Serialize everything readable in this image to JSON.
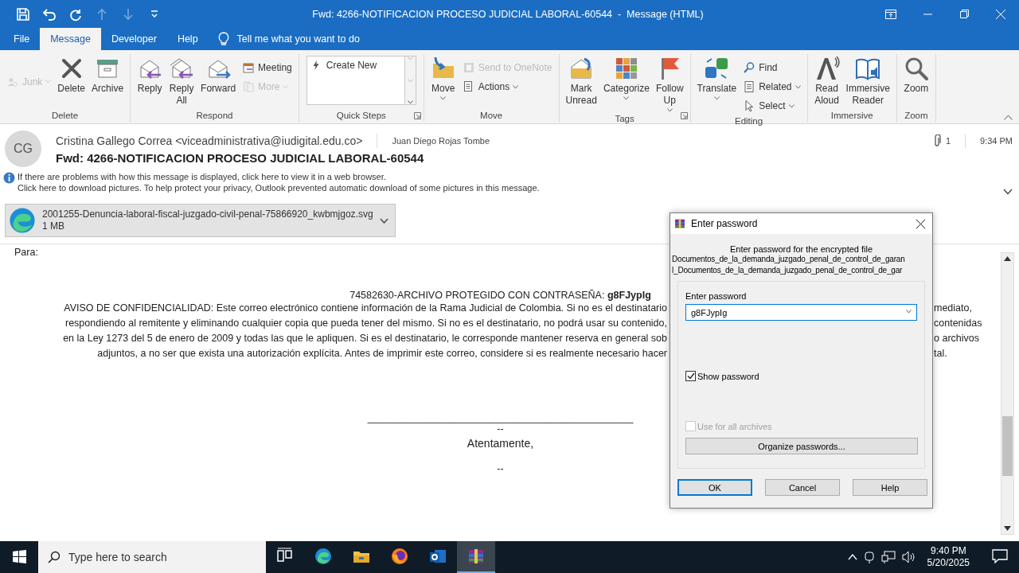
{
  "window": {
    "title": "Fwd: 4266-NOTIFICACION PROCESO JUDICIAL LABORAL-60544  -  Message (HTML)"
  },
  "quick_access": [
    {
      "disabled": false
    },
    {
      "disabled": false
    },
    {
      "disabled": false
    },
    {
      "disabled": true
    },
    {
      "disabled": true
    },
    {
      "disabled": false
    }
  ],
  "tabs": [
    {
      "label": "File",
      "selected": false
    },
    {
      "label": "Message",
      "selected": true
    },
    {
      "label": "Developer",
      "selected": false
    },
    {
      "label": "Help",
      "selected": false
    }
  ],
  "tell_me": {
    "placeholder": "Tell me what you want to do"
  },
  "ribbon": {
    "groups": [
      {
        "label": "Delete",
        "launcher": false,
        "items": [
          {
            "kind": "small",
            "label": "Junk",
            "disabled": true,
            "dropdown": true
          },
          {
            "kind": "large",
            "label": "Delete",
            "disabled": false,
            "dropdown": false
          },
          {
            "kind": "large",
            "label": "Archive",
            "disabled": false,
            "dropdown": false
          }
        ]
      },
      {
        "label": "Respond",
        "launcher": false,
        "items": [
          {
            "kind": "large",
            "label": "Reply",
            "disabled": false,
            "dropdown": false
          },
          {
            "kind": "large",
            "label": "Reply All",
            "disabled": false,
            "dropdown": false
          },
          {
            "kind": "large",
            "label": "Forward",
            "disabled": false,
            "dropdown": false
          },
          {
            "kind": "small",
            "label": "Meeting",
            "disabled": false,
            "dropdown": false
          },
          {
            "kind": "small",
            "label": "More",
            "disabled": true,
            "dropdown": true
          }
        ]
      },
      {
        "label": "Quick Steps",
        "launcher": true,
        "items": [
          {
            "kind": "gallery",
            "label": "Create New",
            "disabled": false,
            "dropdown": false
          }
        ]
      },
      {
        "label": "Move",
        "launcher": false,
        "items": [
          {
            "kind": "large",
            "label": "Move",
            "disabled": false,
            "dropdown": true
          },
          {
            "kind": "small",
            "label": "Send to OneNote",
            "disabled": true,
            "dropdown": false
          },
          {
            "kind": "small",
            "label": "Actions",
            "disabled": false,
            "dropdown": true
          }
        ]
      },
      {
        "label": "Tags",
        "launcher": true,
        "items": [
          {
            "kind": "large",
            "label": "Mark Unread",
            "disabled": false,
            "dropdown": false
          },
          {
            "kind": "large",
            "label": "Categorize",
            "disabled": false,
            "dropdown": true
          },
          {
            "kind": "large",
            "label": "Follow Up",
            "disabled": false,
            "dropdown": true
          }
        ]
      },
      {
        "label": "Editing",
        "launcher": false,
        "items": [
          {
            "kind": "large",
            "label": "Translate",
            "disabled": false,
            "dropdown": true
          },
          {
            "kind": "small",
            "label": "Find",
            "disabled": false,
            "dropdown": false
          },
          {
            "kind": "small",
            "label": "Related",
            "disabled": false,
            "dropdown": true
          },
          {
            "kind": "small",
            "label": "Select",
            "disabled": false,
            "dropdown": true
          }
        ]
      },
      {
        "label": "Immersive",
        "launcher": false,
        "items": [
          {
            "kind": "large",
            "label": "Read Aloud",
            "disabled": false,
            "dropdown": false
          },
          {
            "kind": "large",
            "label": "Immersive Reader",
            "disabled": false,
            "dropdown": false
          }
        ]
      },
      {
        "label": "Zoom",
        "launcher": false,
        "items": [
          {
            "kind": "large",
            "label": "Zoom",
            "disabled": false,
            "dropdown": false
          }
        ]
      }
    ]
  },
  "message": {
    "avatar": "CG",
    "sender": "Cristina Gallego Correa <viceadministrativa@iudigital.edu.co>",
    "to": "Juan Diego Rojas Tombe",
    "attachment_count": "1",
    "time": "9:34 PM",
    "subject": "Fwd: 4266-NOTIFICACION PROCESO JUDICIAL LABORAL-60544",
    "info": [
      "If there are problems with how this message is displayed, click here to view it in a web browser.",
      "Click here to download pictures. To help protect your privacy, Outlook prevented automatic download of some pictures in this message."
    ]
  },
  "attachment": {
    "name": "2001255-Denuncia-laboral-fiscal-juzgado-civil-penal-75866920_kwbmjgoz.svg",
    "size": "1 MB"
  },
  "body": {
    "greeting": "Para:",
    "password_line": "74582630-ARCHIVO  PROTEGIDO CON CONTRASEÑA: **g8FJypIg**",
    "notice": [
      {
        "left": "AVISO DE CONFIDENCIALIDAD: Este correo electrónico contiene información de la Rama Judicial de Colombia. Si no es el destinatario",
        "right": "mediato,"
      },
      {
        "left": "respondiendo al remitente y eliminando cualquier copia que pueda tener del mismo. Si no es el destinatario, no podrá usar su contenido,",
        "right": "contenidas"
      },
      {
        "left": "en la Ley 1273  del 5 de enero de 2009  y todas las que le apliquen. Si es el destinatario, le corresponde mantener reserva en general sob",
        "right": "o archivos"
      },
      {
        "left": "adjuntos, a no ser que exista una autorización explícita. Antes de imprimir este correo, considere si es realmente necesario hacer",
        "right": "tal."
      }
    ],
    "signature": [
      "________________________________________________",
      "--",
      "Atentamente,",
      "--"
    ]
  },
  "dialog": {
    "title": "Enter password",
    "message": "Enter password for the encrypted file",
    "files": [
      "Documentos_de_la_demanda_juzgado_penal_de_control_de_garan",
      "l_Documentos_de_la_demanda_juzgado_penal_de_control_de_gar"
    ],
    "field_label": "Enter password",
    "password": "g8FJypIg",
    "checkboxes": [
      {
        "label": "Show password",
        "checked": true,
        "disabled": false
      },
      {
        "label": "Use for all archives",
        "checked": false,
        "disabled": true
      }
    ],
    "organize": "Organize passwords...",
    "buttons": [
      {
        "label": "OK",
        "default": true
      },
      {
        "label": "Cancel",
        "default": false
      },
      {
        "label": "Help",
        "default": false
      }
    ]
  },
  "taskbar": {
    "search": {
      "placeholder": "Type here to search"
    },
    "apps": [
      {
        "selected": false
      },
      {
        "selected": false
      },
      {
        "selected": false
      },
      {
        "selected": false
      },
      {
        "selected": false
      },
      {
        "selected": true
      }
    ],
    "time": "9:40 PM",
    "date": "5/20/2025"
  }
}
